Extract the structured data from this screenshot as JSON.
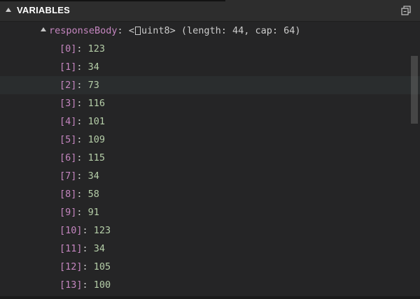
{
  "panel": {
    "title": "VARIABLES"
  },
  "variable": {
    "name": "responseBody",
    "colon": ":",
    "type_prefix": "<",
    "type_suffix": "uint8> (length: 44, cap: 64)",
    "expanded": true
  },
  "items": [
    {
      "index": "[0]",
      "value": "123"
    },
    {
      "index": "[1]",
      "value": "34"
    },
    {
      "index": "[2]",
      "value": "73"
    },
    {
      "index": "[3]",
      "value": "116"
    },
    {
      "index": "[4]",
      "value": "101"
    },
    {
      "index": "[5]",
      "value": "109"
    },
    {
      "index": "[6]",
      "value": "115"
    },
    {
      "index": "[7]",
      "value": "34"
    },
    {
      "index": "[8]",
      "value": "58"
    },
    {
      "index": "[9]",
      "value": "91"
    },
    {
      "index": "[10]",
      "value": "123"
    },
    {
      "index": "[11]",
      "value": "34"
    },
    {
      "index": "[12]",
      "value": "105"
    },
    {
      "index": "[13]",
      "value": "100"
    }
  ],
  "hovered_index": 2,
  "colors": {
    "name": "#c586c0",
    "value": "#b5cea8",
    "text": "#cccccc",
    "background": "#252526"
  },
  "icons": {
    "collapse": "chevron-down-icon",
    "collapse_all": "collapse-all-icon",
    "twistie": "twistie-expanded-icon"
  }
}
